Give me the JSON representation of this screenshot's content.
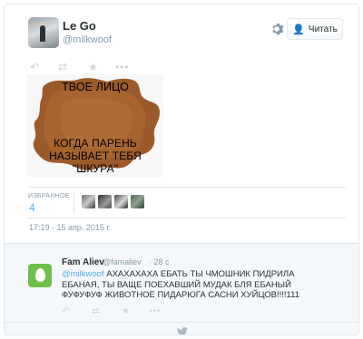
{
  "tweet": {
    "name": "Le Go",
    "handle": "@milkwoof",
    "follow_label": "Читать",
    "image_caption": {
      "line1": "ТВОЕ ЛИЦО",
      "line2": "КОГДА ПАРЕНЬ",
      "line3": "НАЗЫВАЕТ ТЕБЯ",
      "line4": "\"ШКУРА\""
    },
    "favorites_label": "ИЗБРАННОЕ",
    "favorites_count": "4",
    "timestamp": "17:19 - 15 апр. 2015 г."
  },
  "reply": {
    "name": "Fam Aliev",
    "handle": "@famaliev",
    "time": "· 28 с",
    "mention": "@milkwoof",
    "text": " АХАХАХАХА ЕБАТЬ ТЫ ЧМОШНИК ПИДРИЛА ЕБАНАЯ, ТЫ ВАЩЕ ПОЕХАВШИЙ МУДАК БЛЯ ЕБАНЫЙ ФУФУФУФ ЖИВОТНОЕ ПИДАРЮГА САСНИ ХУЙЦОВ!!!!111"
  },
  "icons": {
    "reply": "reply-icon",
    "retweet": "retweet-icon",
    "favorite": "star-icon",
    "more": "more-icon",
    "gear": "gear-icon",
    "follow": "add-user-icon",
    "brand": "bird-icon"
  },
  "colors": {
    "accent": "#55acee",
    "muted": "#8899a6",
    "border": "#e1e8ed"
  }
}
